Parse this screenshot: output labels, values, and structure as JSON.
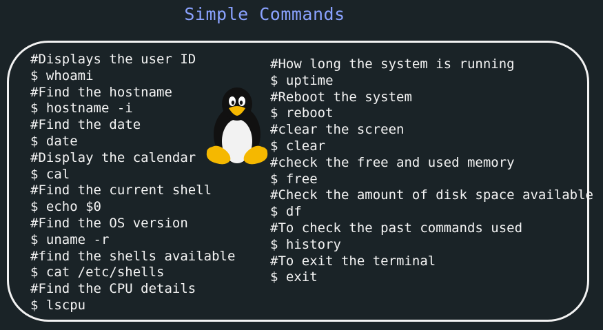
{
  "title": "Simple Commands",
  "left_lines": [
    "#Displays the user ID",
    "$ whoami",
    "#Find the hostname",
    "$ hostname -i",
    "#Find the date",
    "$ date",
    "#Display the calendar",
    "$ cal",
    "#Find the current shell",
    "$ echo $0",
    "#Find the OS version",
    "$ uname -r",
    "#find the shells available",
    "$ cat /etc/shells",
    "#Find the CPU details",
    "$ lscpu"
  ],
  "right_lines": [
    "#How long the system is running",
    "$ uptime",
    "#Reboot the system",
    "$ reboot",
    "#clear the screen",
    "$ clear",
    "#check the free and used memory",
    "$ free",
    "#Check the amount of disk space available",
    "$ df",
    "#To check the past commands used",
    "$ history",
    "#To exit the terminal",
    "$ exit"
  ],
  "colors": {
    "background": "#1a2327",
    "title": "#8aa2ff",
    "text": "#f4f4f4",
    "frame": "#f2f2f2"
  },
  "icon": "tux-penguin-icon"
}
